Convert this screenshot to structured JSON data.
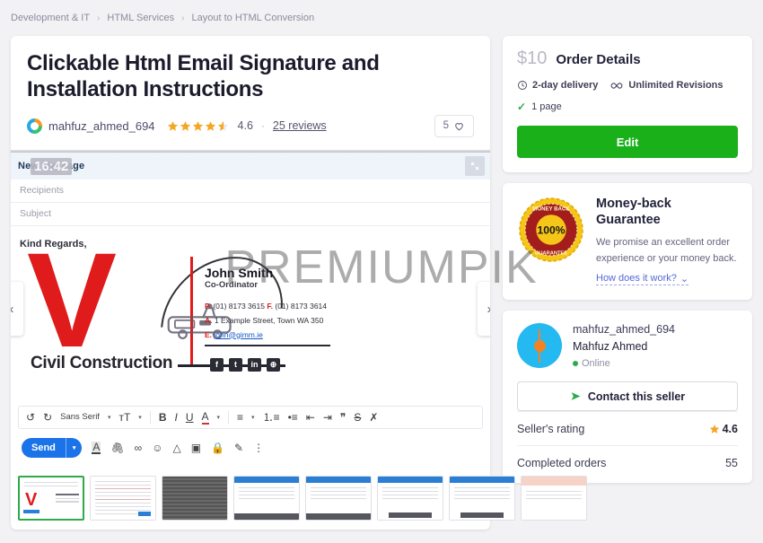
{
  "breadcrumb": [
    {
      "label": "Development & IT"
    },
    {
      "label": "HTML Services"
    },
    {
      "label": "Layout to HTML Conversion"
    }
  ],
  "breadcrumb_separator": "›",
  "gig": {
    "title": "Clickable Html Email Signature and Installation Instructions",
    "seller_username": "mahfuz_ahmed_694",
    "rating_value": "4.6",
    "dot": "·",
    "reviews_label": "25 reviews",
    "favorites_count": "5",
    "heart_icon": "heart-icon"
  },
  "preview": {
    "mail_header_title": "New Message",
    "mail_time": "16:42",
    "recipients_placeholder": "Recipients",
    "subject_placeholder": "Subject",
    "body_greeting": "Kind Regards,",
    "signature": {
      "logo_letter": "V",
      "company": "Civil Construction",
      "person_name": "John Smith",
      "person_role": "Co-Ordinator",
      "phone_label": "P.",
      "phone": "(01) 8173 3615",
      "fax_label": "F.",
      "fax": "(01) 8173 3614",
      "address_label": "A.",
      "address": "1 Example Street, Town WA 350",
      "email_label": "E.",
      "email": "john@gimm.ie",
      "socials": [
        "facebook-icon",
        "twitter-icon",
        "linkedin-icon",
        "globe-icon"
      ]
    },
    "carousel_prev": "‹",
    "carousel_next": "›",
    "expand_icon": "expand-icon"
  },
  "editor_toolbar": {
    "undo": "↺",
    "redo": "↻",
    "font_family": "Sans Serif",
    "font_size_icon": "font-size-icon",
    "bold": "B",
    "italic": "I",
    "underline": "U",
    "text_color": "A",
    "align_icon": "align-icon",
    "bullet_list_icon": "bullet-list-icon",
    "numbered_list_icon": "numbered-list-icon",
    "indent_less_icon": "indent-less-icon",
    "indent_more_icon": "indent-more-icon",
    "quote": "❞",
    "strikethrough": "S",
    "remove_format": "✗"
  },
  "editor_actions": {
    "send_label": "Send",
    "send_caret": "▾",
    "icons": [
      "format-text-icon",
      "attach-file-icon",
      "insert-link-icon",
      "insert-emoji-icon",
      "google-drive-icon",
      "insert-photo-icon",
      "confidential-mode-icon",
      "signature-pen-icon",
      "more-options-icon"
    ]
  },
  "thumbnails": [
    {
      "name": "thumb-signature-preview",
      "style": "signature",
      "selected": true
    },
    {
      "name": "thumb-document-text",
      "style": "doc",
      "selected": false
    },
    {
      "name": "thumb-code-dark",
      "style": "dark",
      "selected": false
    },
    {
      "name": "thumb-webpage-1",
      "style": "web",
      "selected": false
    },
    {
      "name": "thumb-webpage-2",
      "style": "web",
      "selected": false
    },
    {
      "name": "thumb-webpage-3",
      "style": "web",
      "selected": false
    },
    {
      "name": "thumb-webpage-4",
      "style": "web",
      "selected": false
    },
    {
      "name": "thumb-webpage-peach",
      "style": "peach",
      "selected": false
    }
  ],
  "order_details": {
    "price": "$10",
    "title": "Order Details",
    "delivery_icon": "clock-icon",
    "delivery": "2-day delivery",
    "revisions_icon": "infinity-icon",
    "revisions": "Unlimited Revisions",
    "check_icon": "check-icon",
    "pages": "1 page",
    "edit_label": "Edit"
  },
  "money_back": {
    "badge_icon": "money-back-badge-icon",
    "badge_percent": "100%",
    "badge_top_text": "MONEY BACK",
    "badge_bottom_text": "GUARANTEE",
    "title": "Money-back Guarantee",
    "text": "We promise an excellent order experience or your money back.",
    "link": "How does it work?",
    "link_caret": "⌄"
  },
  "seller_card": {
    "avatar_icon": "seller-avatar-icon",
    "username": "mahfuz_ahmed_694",
    "full_name": "Mahfuz Ahmed",
    "status": "Online",
    "contact_icon": "send-plane-icon",
    "contact_label": "Contact this seller",
    "rating_label": "Seller's rating",
    "rating_value": "4.6",
    "orders_label": "Completed orders",
    "orders_value": "55"
  },
  "watermark": {
    "text": "PREMIUMPIK"
  },
  "colors": {
    "accent_green": "#19b01a",
    "star_gold": "#f5a623",
    "link_blue": "#5568d6",
    "send_blue": "#1a73e8",
    "page_bg": "#f2f2f4"
  }
}
